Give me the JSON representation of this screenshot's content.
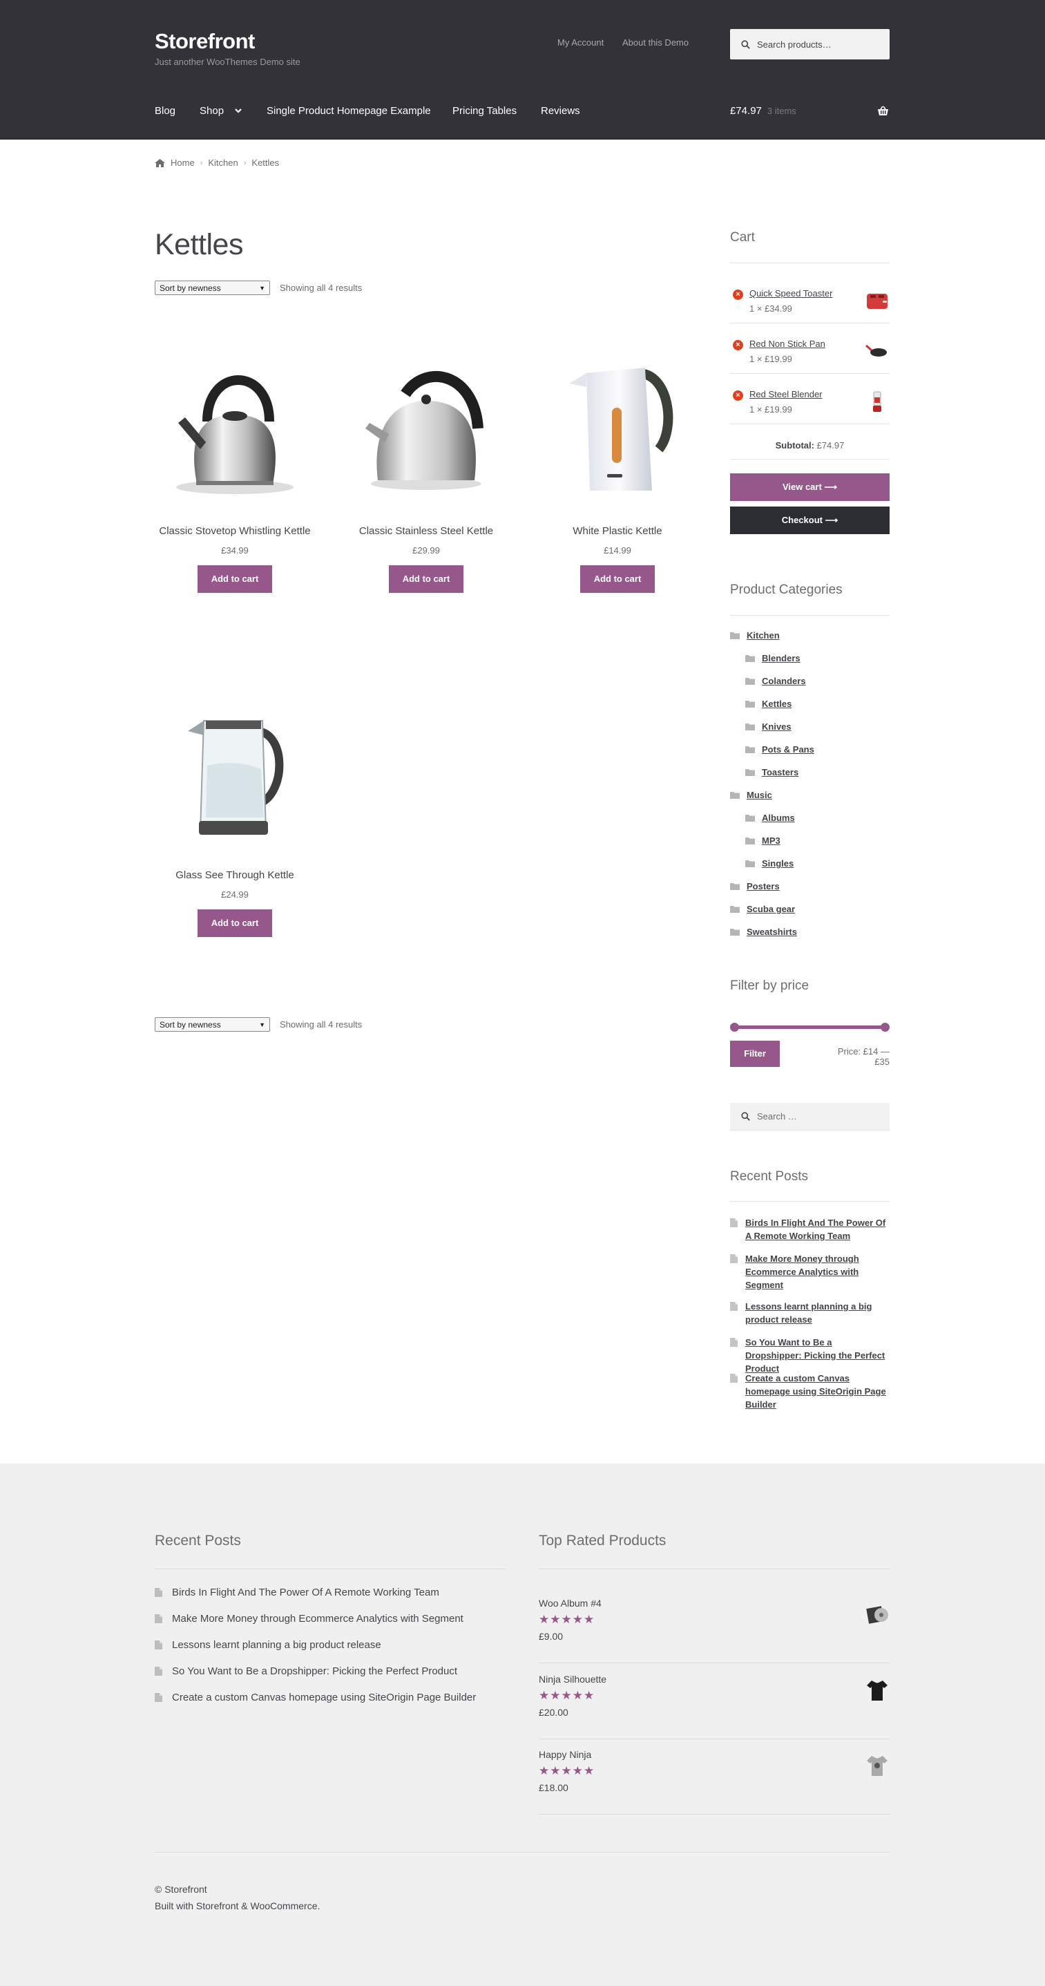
{
  "header": {
    "site_title": "Storefront",
    "tagline": "Just another WooThemes Demo site",
    "top_links": [
      "My Account",
      "About this Demo"
    ],
    "search_placeholder": "Search products…",
    "nav": [
      "Blog",
      "Shop",
      "Single Product Homepage Example",
      "Pricing Tables",
      "Reviews"
    ],
    "cart_total": "£74.97",
    "cart_count": "3 items"
  },
  "breadcrumb": [
    "Home",
    "Kitchen",
    "Kettles"
  ],
  "page_title": "Kettles",
  "sort": {
    "label": "Sort by newness",
    "showing": "Showing all 4 results"
  },
  "products": [
    {
      "name": "Classic Stovetop Whistling Kettle",
      "price": "£34.99",
      "button": "Add to cart"
    },
    {
      "name": "Classic Stainless Steel Kettle",
      "price": "£29.99",
      "button": "Add to cart"
    },
    {
      "name": "White Plastic Kettle",
      "price": "£14.99",
      "button": "Add to cart"
    },
    {
      "name": "Glass See Through Kettle",
      "price": "£24.99",
      "button": "Add to cart"
    }
  ],
  "sidebar": {
    "cart": {
      "title": "Cart",
      "items": [
        {
          "name": "Quick Speed Toaster",
          "qty": "1 × £34.99"
        },
        {
          "name": "Red Non Stick Pan",
          "qty": "1 × £19.99"
        },
        {
          "name": "Red Steel Blender",
          "qty": "1 × £19.99"
        }
      ],
      "subtotal_label": "Subtotal:",
      "subtotal": "£74.97",
      "view_cart": "View cart",
      "checkout": "Checkout"
    },
    "categories": {
      "title": "Product Categories",
      "items": [
        "Kitchen",
        "Blenders",
        "Colanders",
        "Kettles",
        "Knives",
        "Pots & Pans",
        "Toasters",
        "Music",
        "Albums",
        "MP3",
        "Singles",
        "Posters",
        "Scuba gear",
        "Sweatshirts"
      ]
    },
    "price_filter": {
      "title": "Filter by price",
      "button": "Filter",
      "range": "Price: £14 — £35"
    },
    "search_placeholder": "Search …",
    "recent_posts": {
      "title": "Recent Posts",
      "items": [
        "Birds In Flight And The Power Of A Remote Working Team",
        "Make More Money through Ecommerce Analytics with Segment",
        "Lessons learnt planning a big product release",
        "So You Want to Be a Dropshipper: Picking the Perfect Product",
        "Create a custom Canvas homepage using SiteOrigin Page Builder"
      ]
    }
  },
  "footer": {
    "recent_posts_title": "Recent Posts",
    "recent_posts": [
      "Birds In Flight And The Power Of A Remote Working Team",
      "Make More Money through Ecommerce Analytics with Segment",
      "Lessons learnt planning a big product release",
      "So You Want to Be a Dropshipper: Picking the Perfect Product",
      "Create a custom Canvas homepage using SiteOrigin Page Builder"
    ],
    "top_rated_title": "Top Rated Products",
    "top_rated": [
      {
        "name": "Woo Album #4",
        "price": "£9.00",
        "rating": 5
      },
      {
        "name": "Ninja Silhouette",
        "price": "£20.00",
        "rating": 5
      },
      {
        "name": "Happy Ninja",
        "price": "£18.00",
        "rating": 5
      }
    ],
    "copyright": "© Storefront",
    "credit": "Built with Storefront & WooCommerce."
  },
  "colors": {
    "header_bg": "#333238",
    "accent": "#96588a",
    "checkout_bg": "#2c2d33",
    "footer_bg": "#f0f0f0",
    "remove": "#e2401c"
  }
}
